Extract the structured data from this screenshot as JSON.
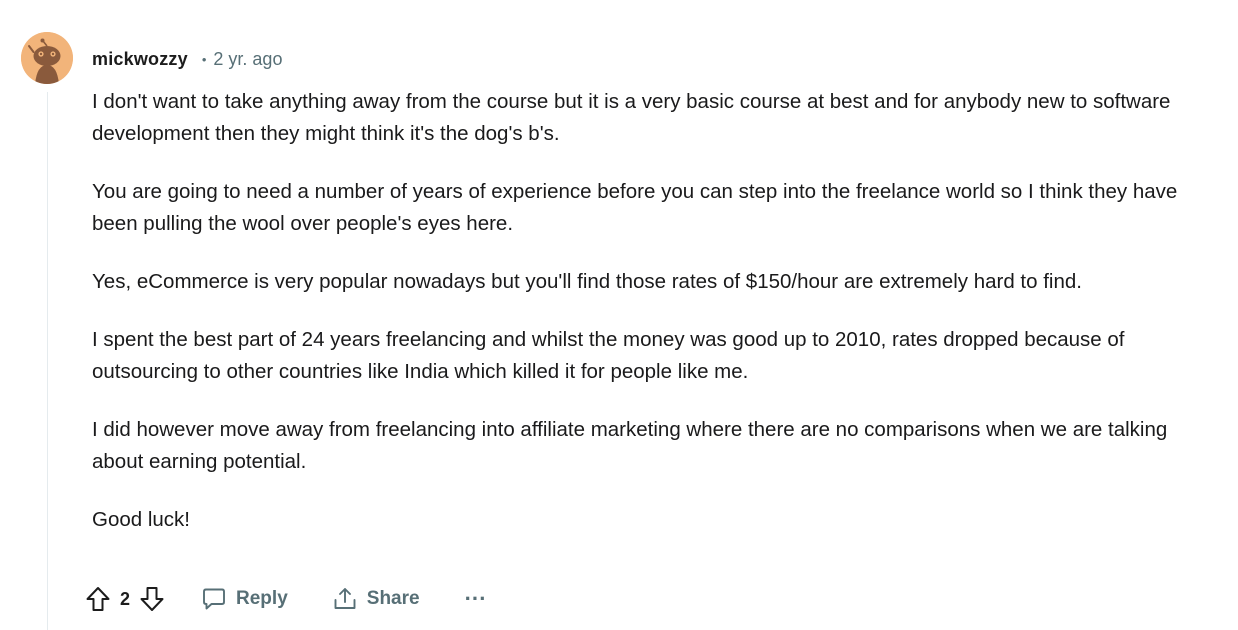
{
  "comment": {
    "author": "mickwozzy",
    "separator": "•",
    "timestamp": "2 yr. ago",
    "paragraphs": [
      "I don't want to take anything away from the course but it is a very basic course at best and for anybody new to software development then they might think it's the dog's b's.",
      "You are going to need a number of years of experience before you can step into the freelance world so I think they have been pulling the wool over people's eyes here.",
      "Yes, eCommerce is very popular nowadays but you'll find those rates of $150/hour are extremely hard to find.",
      "I spent the best part of 24 years freelancing and whilst the money was good up to 2010, rates dropped because of outsourcing to other countries like India which killed it for people like me.",
      "I did however move away from freelancing into affiliate marketing where there are no comparisons when we are talking about earning potential.",
      "Good luck!"
    ]
  },
  "actions": {
    "score": "2",
    "reply_label": "Reply",
    "share_label": "Share",
    "more_label": "···"
  },
  "icons": {
    "avatar": "snoo-avatar-icon",
    "upvote": "upvote-arrow-icon",
    "downvote": "downvote-arrow-icon",
    "reply": "speech-bubble-icon",
    "share": "share-upload-icon",
    "more": "ellipsis-icon"
  },
  "colors": {
    "avatar_bg": "#f2b47a",
    "avatar_figure": "#8a5a3c",
    "muted_text": "#576f76",
    "thread_line": "#e5ebee"
  }
}
